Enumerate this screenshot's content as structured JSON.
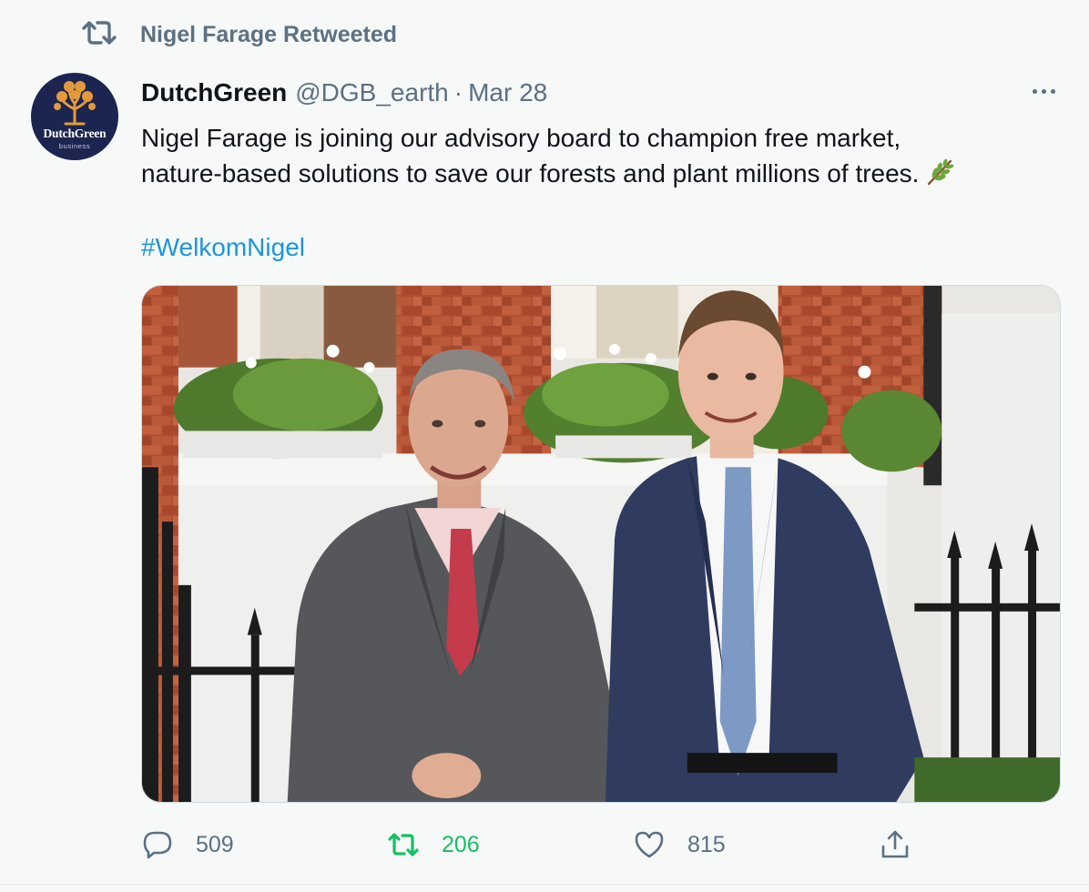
{
  "retweet_context": {
    "icon": "retweet-icon",
    "label": "Nigel Farage Retweeted"
  },
  "author": {
    "avatar_brand": "DutchGreen",
    "avatar_sub": "business",
    "display_name": "DutchGreen",
    "handle": "@DGB_earth",
    "separator": "·",
    "date": "Mar 28"
  },
  "tweet": {
    "text_line1": "Nigel Farage is joining our advisory board to champion free market,",
    "text_line2": "nature-based solutions to save our forests and plant millions of trees.",
    "emoji": "herb-emoji",
    "hashtag": "#WelkomNigel"
  },
  "media": {
    "type": "photo"
  },
  "actions": {
    "reply": {
      "icon": "reply-icon",
      "count": "509"
    },
    "retweet": {
      "icon": "retweet-icon",
      "count": "206",
      "active": true
    },
    "like": {
      "icon": "heart-icon",
      "count": "815"
    },
    "share": {
      "icon": "share-icon"
    }
  },
  "colors": {
    "secondary_text": "#5b7083",
    "link": "#1b95e0",
    "retweet_active": "#17bf63",
    "avatar_bg": "#1c2550",
    "logo_orange": "#e39a3c"
  }
}
